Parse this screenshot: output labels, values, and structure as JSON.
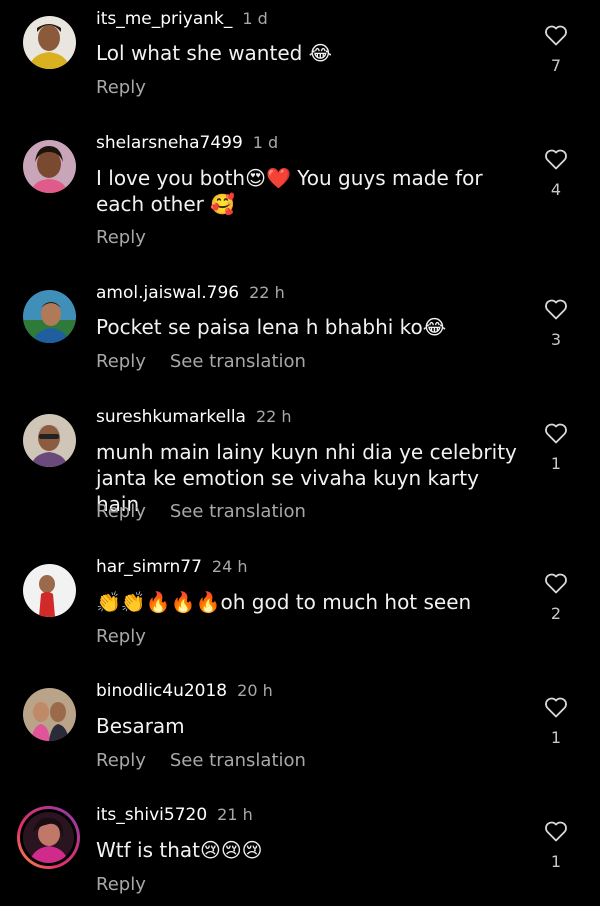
{
  "comments": [
    {
      "username": "its_me_priyank_",
      "time": "1 d",
      "text": "Lol what she wanted 😂",
      "reply": "Reply",
      "translate": "",
      "likes": "7"
    },
    {
      "username": "shelarsneha7499",
      "time": "1 d",
      "text": "I love you both😍❤️ You guys made for each other 🥰",
      "reply": "Reply",
      "translate": "",
      "likes": "4"
    },
    {
      "username": "amol.jaiswal.796",
      "time": "22 h",
      "text": "Pocket se paisa lena h bhabhi ko😂",
      "reply": "Reply",
      "translate": "See translation",
      "likes": "3"
    },
    {
      "username": "sureshkumarkella",
      "time": "22 h",
      "text": "munh main lainy kuyn nhi dia ye celebrity janta ke emotion se vivaha kuyn karty hain",
      "reply": "Reply",
      "translate": "See translation",
      "likes": "1"
    },
    {
      "username": "har_simrn77",
      "time": "24 h",
      "text": "👏👏🔥🔥🔥oh god to much hot seen",
      "reply": "Reply",
      "translate": "",
      "likes": "2"
    },
    {
      "username": "binodlic4u2018",
      "time": "20 h",
      "text": "Besaram",
      "reply": "Reply",
      "translate": "See translation",
      "likes": "1"
    },
    {
      "username": "its_shivi5720",
      "time": "21 h",
      "text": "Wtf is that😢😢😢",
      "reply": "Reply",
      "translate": "",
      "likes": "1"
    }
  ],
  "colors": {
    "background": "#000000",
    "secondary_text": "#a8a8a8",
    "story_ring": "#e1306c"
  }
}
